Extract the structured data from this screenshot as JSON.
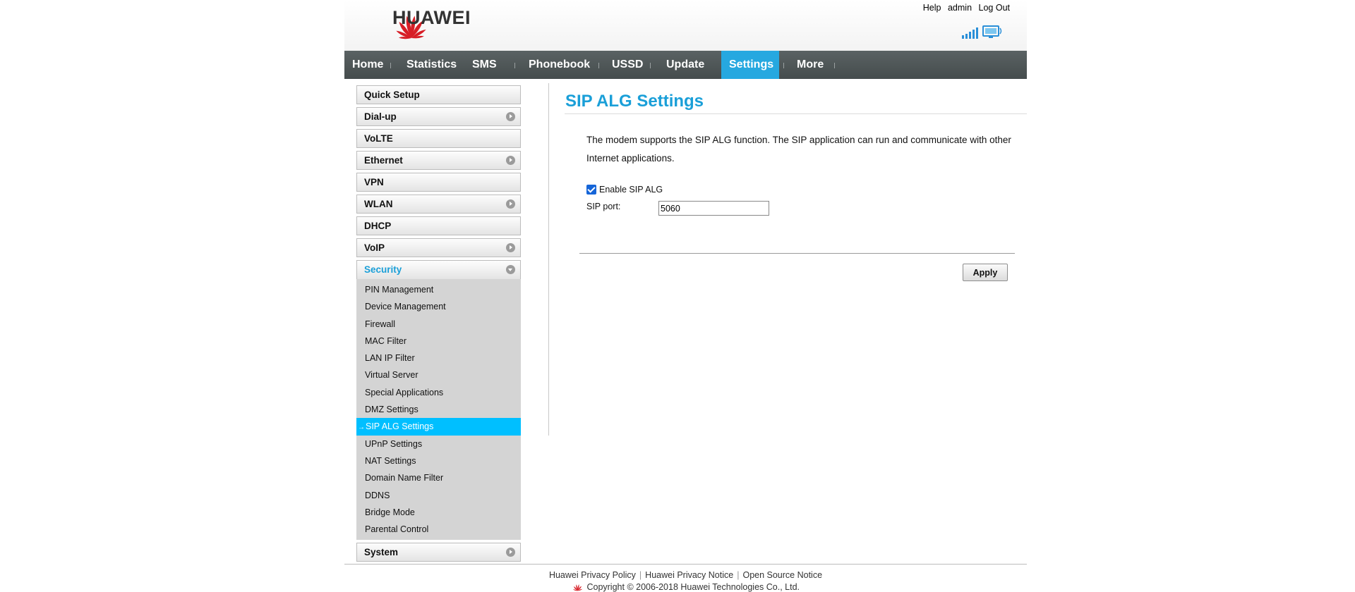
{
  "brand": {
    "name": "HUAWEI"
  },
  "top_links": {
    "help": "Help",
    "user": "admin",
    "logout": "Log Out"
  },
  "status_icons": [
    "signal-strength-icon",
    "monitor-icon"
  ],
  "nav": {
    "items": [
      "Home",
      "Statistics",
      "SMS",
      "Phonebook",
      "USSD",
      "Update",
      "Settings",
      "More"
    ],
    "active": "Settings"
  },
  "sidebar": {
    "items": [
      "Quick Setup",
      "Dial-up",
      "VoLTE",
      "Ethernet",
      "VPN",
      "WLAN",
      "DHCP",
      "VoIP",
      "Security",
      "System"
    ],
    "open_section": "Security",
    "security_items": [
      "PIN Management",
      "Device Management",
      "Firewall",
      "MAC Filter",
      "LAN IP Filter",
      "Virtual Server",
      "Special Applications",
      "DMZ Settings",
      "SIP ALG Settings",
      "UPnP Settings",
      "NAT Settings",
      "Domain Name Filter",
      "DDNS",
      "Bridge Mode",
      "Parental Control"
    ],
    "active_item": "SIP ALG Settings"
  },
  "content": {
    "title": "SIP ALG Settings",
    "description": "The modem supports the SIP ALG function. The SIP application can run and communicate with other Internet applications.",
    "enable_label": "Enable SIP ALG",
    "enable_checked": true,
    "port_label": "SIP port:",
    "port_value": "5060",
    "apply_label": "Apply"
  },
  "footer": {
    "links": [
      "Huawei Privacy Policy",
      "Huawei Privacy Notice",
      "Open Source Notice"
    ],
    "copyright": "Copyright © 2006-2018 Huawei Technologies Co., Ltd."
  },
  "colors": {
    "accent": "#1a9fd8",
    "nav_active": "#26a8e0",
    "nav_bg": "#4f5657",
    "sub_active": "#00bfff",
    "logo_red": "#d71e26"
  }
}
